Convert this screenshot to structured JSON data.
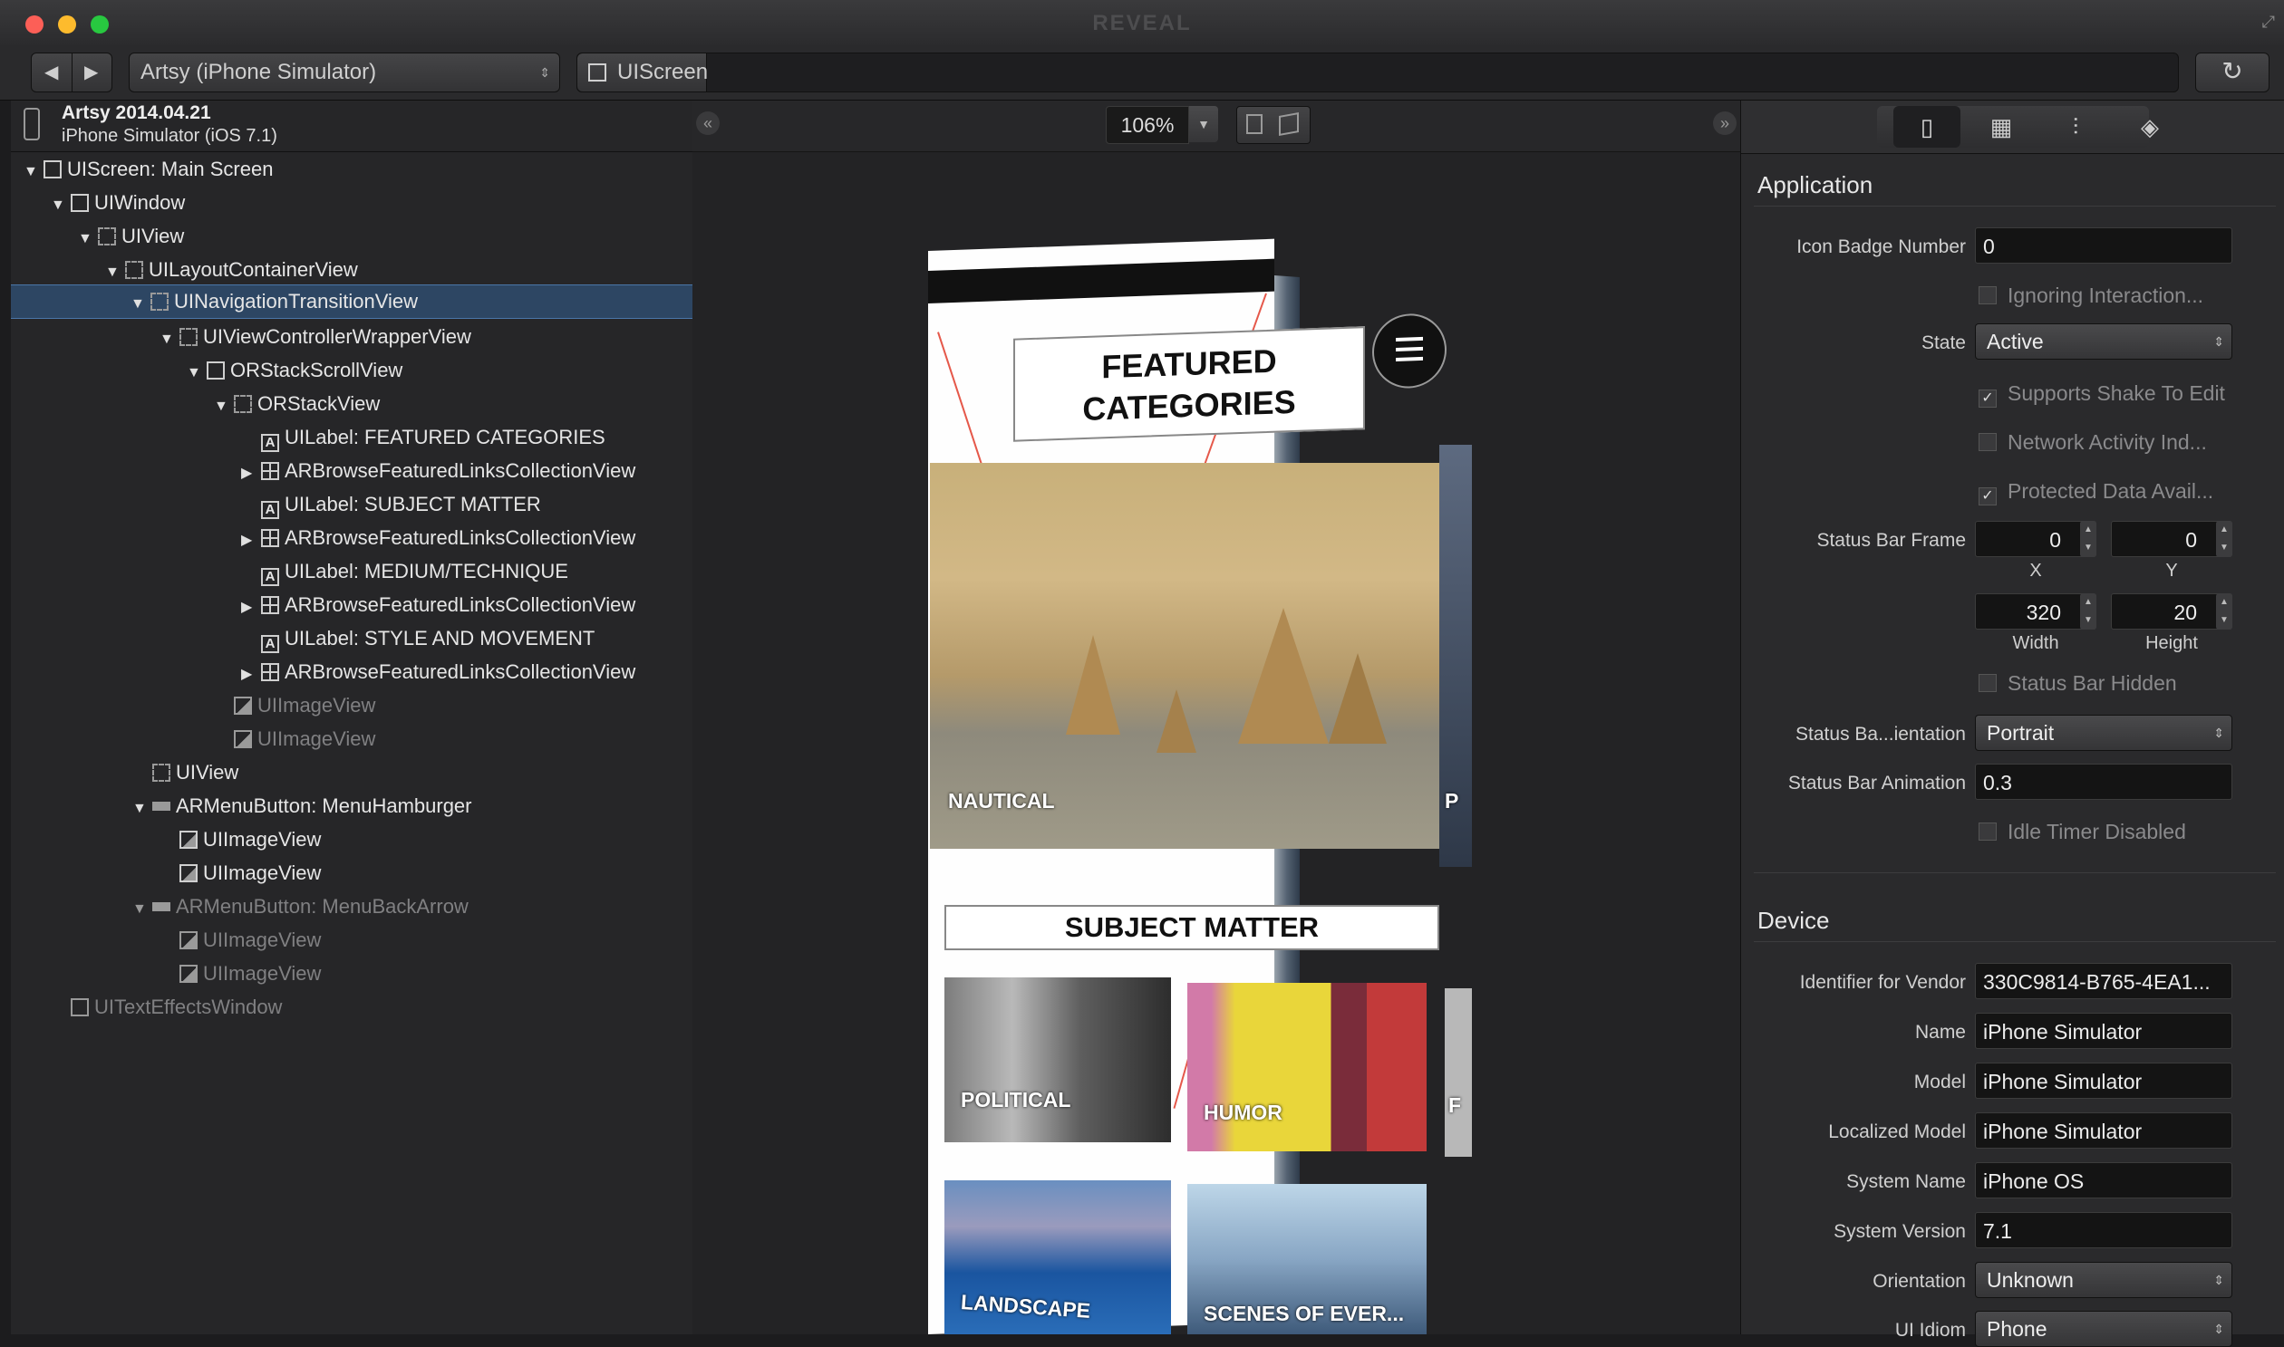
{
  "window": {
    "title": "REVEAL"
  },
  "toolbar": {
    "device": "Artsy (iPhone Simulator)",
    "breadcrumb": "UIScreen",
    "back_icon": "chevron-left-icon",
    "forward_icon": "chevron-right-icon",
    "refresh_icon": "refresh-icon"
  },
  "app_header": {
    "line1": "Artsy 2014.04.21",
    "line2": "iPhone Simulator (iOS 7.1)"
  },
  "tree": [
    {
      "label": "UIScreen: Main Screen",
      "icon": "screen-icon"
    },
    {
      "label": "UIWindow",
      "icon": "window-icon"
    },
    {
      "label": "UIView",
      "icon": "view-icon"
    },
    {
      "label": "UILayoutContainerView",
      "icon": "view-icon"
    },
    {
      "label": "UINavigationTransitionView",
      "icon": "view-icon"
    },
    {
      "label": "UIViewControllerWrapperView",
      "icon": "view-icon"
    },
    {
      "label": "ORStackScrollView",
      "icon": "scrollview-icon"
    },
    {
      "label": "ORStackView",
      "icon": "view-icon"
    },
    {
      "label": "UILabel: FEATURED CATEGORIES",
      "icon": "label-icon"
    },
    {
      "label": "ARBrowseFeaturedLinksCollectionView",
      "icon": "collectionview-icon"
    },
    {
      "label": "UILabel: SUBJECT MATTER",
      "icon": "label-icon"
    },
    {
      "label": "ARBrowseFeaturedLinksCollectionView",
      "icon": "collectionview-icon"
    },
    {
      "label": "UILabel: MEDIUM/TECHNIQUE",
      "icon": "label-icon"
    },
    {
      "label": "ARBrowseFeaturedLinksCollectionView",
      "icon": "collectionview-icon"
    },
    {
      "label": "UILabel: STYLE AND MOVEMENT",
      "icon": "label-icon"
    },
    {
      "label": "ARBrowseFeaturedLinksCollectionView",
      "icon": "collectionview-icon"
    },
    {
      "label": "UIImageView",
      "icon": "imageview-icon"
    },
    {
      "label": "UIImageView",
      "icon": "imageview-icon"
    },
    {
      "label": "UIView",
      "icon": "view-icon"
    },
    {
      "label": "ARMenuButton: MenuHamburger",
      "icon": "button-icon"
    },
    {
      "label": "UIImageView",
      "icon": "imageview-icon"
    },
    {
      "label": "UIImageView",
      "icon": "imageview-icon"
    },
    {
      "label": "ARMenuButton: MenuBackArrow",
      "icon": "button-icon"
    },
    {
      "label": "UIImageView",
      "icon": "imageview-icon"
    },
    {
      "label": "UIImageView",
      "icon": "imageview-icon"
    },
    {
      "label": "UITextEffectsWindow",
      "icon": "window-icon"
    }
  ],
  "canvas": {
    "zoom": "106%",
    "featured_title_1": "FEATURED",
    "featured_title_2": "CATEGORIES",
    "subject_title": "SUBJECT MATTER",
    "tiles": {
      "nautical": "NAUTICAL",
      "partial_p": "P",
      "political": "POLITICAL",
      "humor": "HUMOR",
      "partial_f": "F",
      "landscape": "LANDSCAPE",
      "scenes": "SCENES OF EVER..."
    }
  },
  "inspector": {
    "tabs": [
      "file-icon",
      "table-icon",
      "sliders-icon",
      "layers-icon"
    ],
    "application": {
      "title": "Application",
      "icon_badge_label": "Icon Badge Number",
      "icon_badge_value": "0",
      "ignoring_interaction": "Ignoring Interaction...",
      "state_label": "State",
      "state_value": "Active",
      "supports_shake": "Supports Shake To Edit",
      "network_activity": "Network Activity Ind...",
      "protected_data": "Protected Data Avail...",
      "status_bar_frame_label": "Status Bar Frame",
      "frame_x": "0",
      "frame_y": "0",
      "frame_width": "320",
      "frame_height": "20",
      "x_label": "X",
      "y_label": "Y",
      "width_label": "Width",
      "height_label": "Height",
      "status_bar_hidden": "Status Bar Hidden",
      "orientation_label": "Status Ba...ientation",
      "orientation_value": "Portrait",
      "animation_label": "Status Bar Animation",
      "animation_value": "0.3",
      "idle_timer": "Idle Timer Disabled"
    },
    "device": {
      "title": "Device",
      "vendor_label": "Identifier for Vendor",
      "vendor_value": "330C9814-B765-4EA1...",
      "name_label": "Name",
      "name_value": "iPhone Simulator",
      "model_label": "Model",
      "model_value": "iPhone Simulator",
      "localized_label": "Localized Model",
      "localized_value": "iPhone Simulator",
      "system_name_label": "System Name",
      "system_name_value": "iPhone OS",
      "system_version_label": "System Version",
      "system_version_value": "7.1",
      "orientation_label": "Orientation",
      "orientation_value": "Unknown",
      "idiom_label": "UI Idiom",
      "idiom_value": "Phone"
    }
  }
}
